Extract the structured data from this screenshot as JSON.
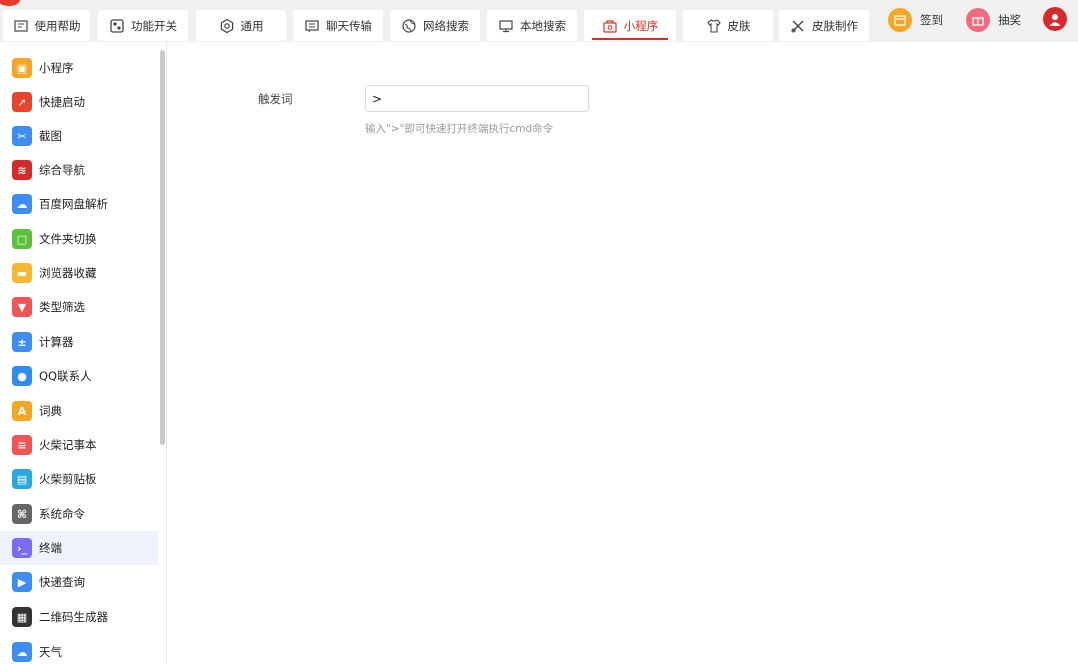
{
  "tabs": [
    {
      "label": "使用帮助",
      "icon": "help-doc-icon"
    },
    {
      "label": "功能开关",
      "icon": "toggle-switch-icon"
    },
    {
      "label": "通用",
      "icon": "gear-icon"
    },
    {
      "label": "聊天传输",
      "icon": "chat-transfer-icon"
    },
    {
      "label": "网络搜索",
      "icon": "globe-icon"
    },
    {
      "label": "本地搜索",
      "icon": "monitor-icon"
    },
    {
      "label": "小程序",
      "icon": "mini-program-icon",
      "active": true
    },
    {
      "label": "皮肤",
      "icon": "tshirt-icon"
    },
    {
      "label": "皮肤制作",
      "icon": "skin-tools-icon"
    }
  ],
  "actions": {
    "signin_label": "签到",
    "lottery_label": "抽奖"
  },
  "sidebar": {
    "items": [
      {
        "label": "小程序",
        "color": "#f5a623",
        "glyph": "▣"
      },
      {
        "label": "快捷启动",
        "color": "#e8452c",
        "glyph": "➚"
      },
      {
        "label": "截图",
        "color": "#3d8ef0",
        "glyph": "✂"
      },
      {
        "label": "综合导航",
        "color": "#d62b2b",
        "glyph": "≋"
      },
      {
        "label": "百度网盘解析",
        "color": "#3d8ef0",
        "glyph": "☁"
      },
      {
        "label": "文件夹切换",
        "color": "#5cc13a",
        "glyph": "□"
      },
      {
        "label": "浏览器收藏",
        "color": "#f7b731",
        "glyph": "▬"
      },
      {
        "label": "类型筛选",
        "color": "#f05454",
        "glyph": "▼"
      },
      {
        "label": "计算器",
        "color": "#3d8ef0",
        "glyph": "±"
      },
      {
        "label": "QQ联系人",
        "color": "#2f8cf0",
        "glyph": "●"
      },
      {
        "label": "词典",
        "color": "#f5a623",
        "glyph": "A"
      },
      {
        "label": "火柴记事本",
        "color": "#f05454",
        "glyph": "≡"
      },
      {
        "label": "火柴剪贴板",
        "color": "#29a8e0",
        "glyph": "▤"
      },
      {
        "label": "系统命令",
        "color": "#666666",
        "glyph": "⌘"
      },
      {
        "label": "终端",
        "color": "#7b6cf0",
        "glyph": "›_",
        "selected": true
      },
      {
        "label": "快递查询",
        "color": "#3d8ef0",
        "glyph": "▶"
      },
      {
        "label": "二维码生成器",
        "color": "#333333",
        "glyph": "▦"
      },
      {
        "label": "天气",
        "color": "#3d8ef0",
        "glyph": "☁"
      }
    ]
  },
  "main": {
    "trigger_label": "触发词",
    "trigger_value": ">",
    "hint": "输入\">\"即可快速打开终端执行cmd命令"
  },
  "colors": {
    "accent": "#d93025",
    "selected_bg": "#eef2fb",
    "topbar_bg": "#f0f0f0"
  }
}
